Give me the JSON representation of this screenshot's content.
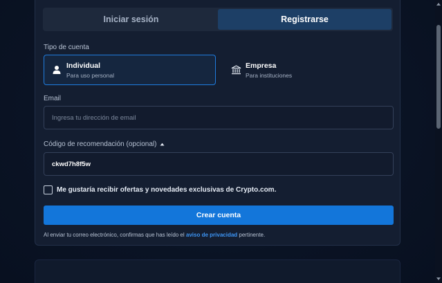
{
  "tabs": [
    {
      "label": "Iniciar sesión",
      "active": false
    },
    {
      "label": "Registrarse",
      "active": true
    }
  ],
  "account_type": {
    "label": "Tipo de cuenta",
    "options": [
      {
        "title": "Individual",
        "subtitle": "Para uso personal",
        "icon": "person-icon",
        "selected": true
      },
      {
        "title": "Empresa",
        "subtitle": "Para instituciones",
        "icon": "bank-icon",
        "selected": false
      }
    ]
  },
  "email": {
    "label": "Email",
    "placeholder": "Ingresa tu dirección de email",
    "value": ""
  },
  "referral": {
    "label": "Código de recomendación (opcional)",
    "toggle_icon": "caret-up-icon",
    "value": "ckwd7h8f5w"
  },
  "newsletter": {
    "label": "Me gustaría recibir ofertas y novedades exclusivas de Crypto.com.",
    "checked": false
  },
  "submit": {
    "label": "Crear cuenta"
  },
  "legal": {
    "prefix": "Al enviar tu correo electrónico, confirmas que has leído el",
    "link": "aviso de privacidad",
    "suffix": "pertinente."
  },
  "colors": {
    "accent": "#1376da",
    "link": "#3d95f5",
    "card_bg": "#141e31",
    "page_bg": "#0b1426"
  }
}
